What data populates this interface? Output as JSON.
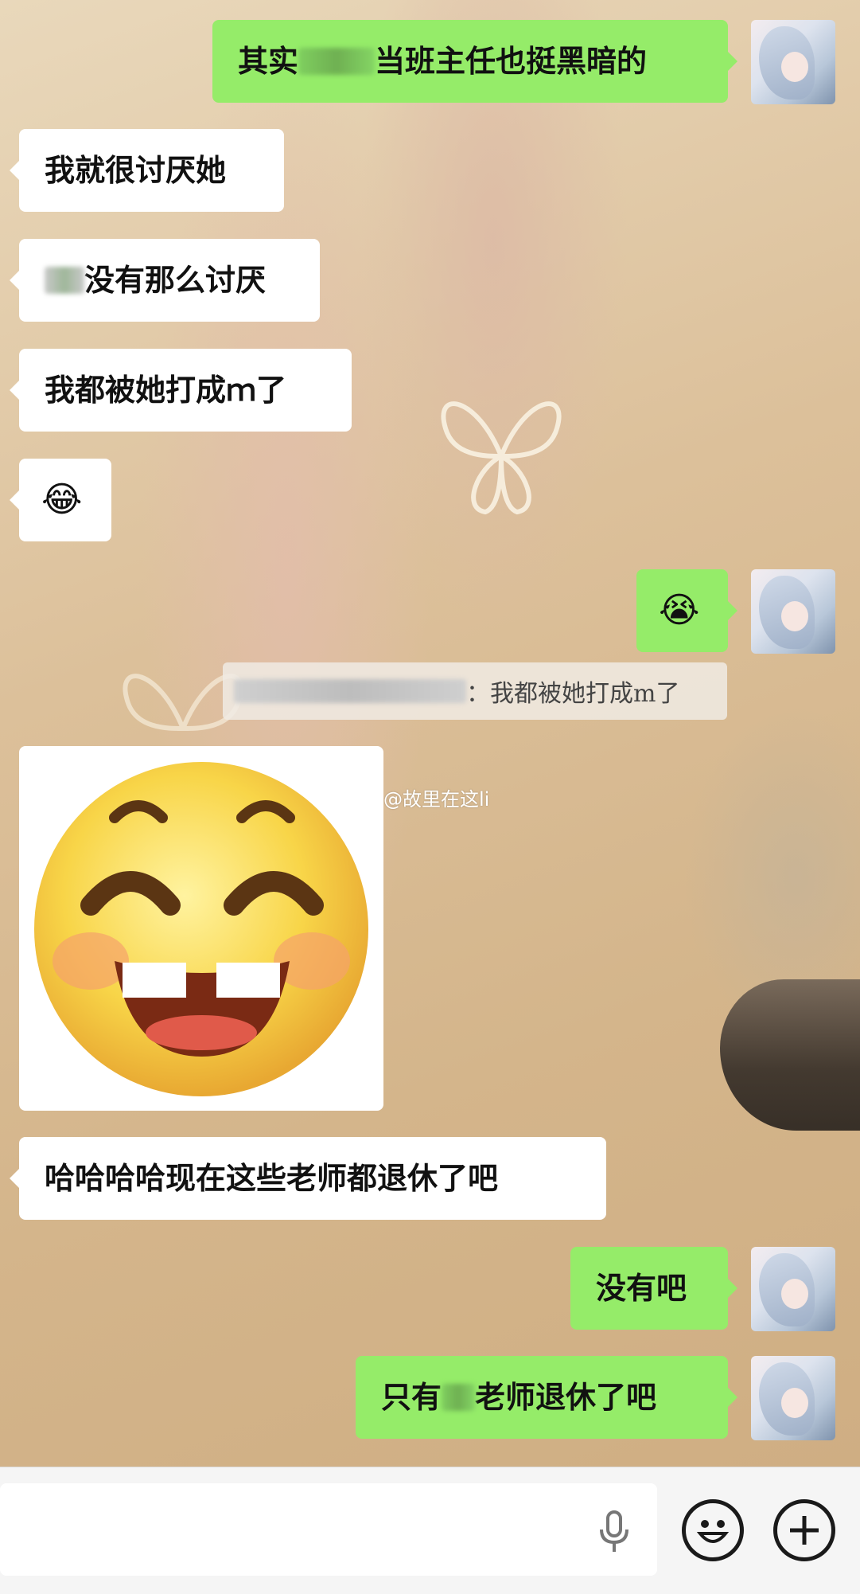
{
  "chat": {
    "messages": [
      {
        "side": "right",
        "prefix": "其实",
        "suffix": "当班主任也挺黑暗的"
      },
      {
        "side": "left",
        "text": "我就很讨厌她"
      },
      {
        "side": "left",
        "text": "没有那么讨厌"
      },
      {
        "side": "left",
        "text": "我都被她打成ｍ了"
      },
      {
        "side": "left",
        "emoji": "😂"
      },
      {
        "side": "right",
        "emoji": "😭"
      },
      {
        "side": "left",
        "text": "哈哈哈哈现在这些老师都退休了吧"
      },
      {
        "side": "right",
        "text": "没有吧"
      },
      {
        "side": "right",
        "prefix": "只有",
        "suffix": "老师退休了吧"
      }
    ],
    "quote_text": "：我都被她打成m了",
    "sticker": "laughing-face-sticker"
  },
  "watermark": "@故里在这li",
  "input_bar": {
    "voice_icon": "microphone-icon",
    "emoji_icon": "smiley-icon",
    "more_icon": "plus-icon"
  },
  "colors": {
    "sent_bubble": "#95ec69",
    "received_bubble": "#ffffff",
    "input_bar": "#f5f5f5"
  }
}
